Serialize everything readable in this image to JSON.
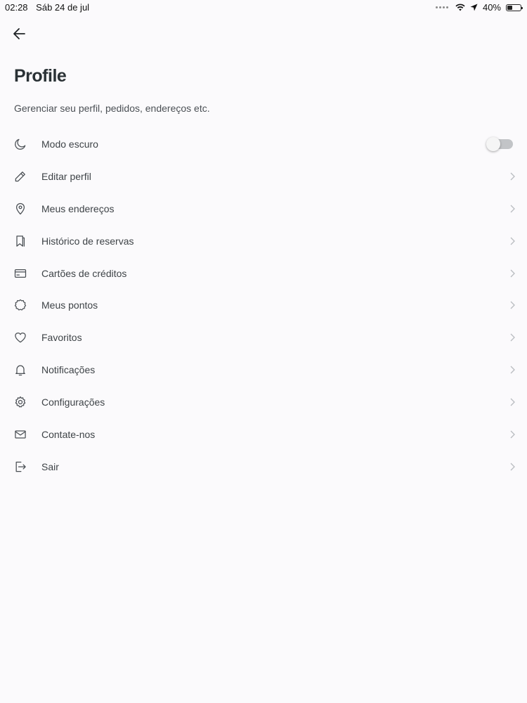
{
  "status_bar": {
    "time": "02:28",
    "date": "Sáb 24 de jul",
    "battery": "40%",
    "battery_level": 0.4,
    "icons": [
      "dots-icon",
      "wifi-icon",
      "location-arrow-icon",
      "battery-icon"
    ]
  },
  "header": {
    "back_icon": "arrow-left-icon",
    "title": "Profile",
    "subtitle": "Gerenciar seu perfil, pedidos, endereços etc."
  },
  "menu": {
    "items": [
      {
        "label": "Modo escuro",
        "icon": "moon-icon",
        "control": "toggle",
        "toggle_on": false
      },
      {
        "label": "Editar perfil",
        "icon": "pencil-icon",
        "control": "chevron"
      },
      {
        "label": "Meus endereços",
        "icon": "map-pin-icon",
        "control": "chevron"
      },
      {
        "label": "Histórico de reservas",
        "icon": "bookmark-icon",
        "control": "chevron"
      },
      {
        "label": "Cartões de créditos",
        "icon": "credit-card-icon",
        "control": "chevron"
      },
      {
        "label": "Meus pontos",
        "icon": "badge-icon",
        "control": "chevron"
      },
      {
        "label": "Favoritos",
        "icon": "heart-icon",
        "control": "chevron"
      },
      {
        "label": "Notificações",
        "icon": "bell-icon",
        "control": "chevron"
      },
      {
        "label": "Configurações",
        "icon": "gear-icon",
        "control": "chevron"
      },
      {
        "label": "Contate-nos",
        "icon": "mail-icon",
        "control": "chevron"
      },
      {
        "label": "Sair",
        "icon": "logout-icon",
        "control": "chevron"
      }
    ]
  },
  "colors": {
    "background": "#fbfafc",
    "title": "#2a3135",
    "text": "#3e4347",
    "chevron": "#b9bcc0",
    "toggle_track": "#c2c4c7"
  }
}
